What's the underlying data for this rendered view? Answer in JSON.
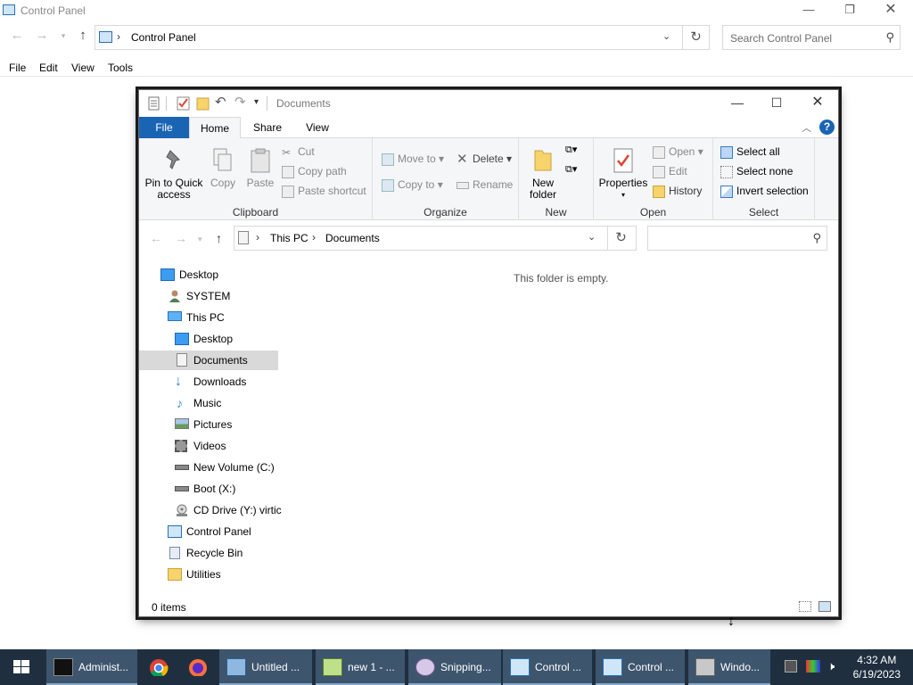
{
  "control_panel": {
    "title": "Control Panel",
    "address": {
      "separator": "›",
      "crumb": "Control Panel"
    },
    "search_placeholder": "Search Control Panel",
    "menu": [
      "File",
      "Edit",
      "View",
      "Tools"
    ]
  },
  "explorer": {
    "title": "Documents",
    "tabs": [
      "File",
      "Home",
      "Share",
      "View"
    ],
    "ribbon": {
      "clipboard": {
        "group_label": "Clipboard",
        "pin": "Pin to Quick access",
        "copy": "Copy",
        "paste": "Paste",
        "cut": "Cut",
        "copy_path": "Copy path",
        "paste_shortcut": "Paste shortcut"
      },
      "organize": {
        "group_label": "Organize",
        "move_to": "Move to",
        "copy_to": "Copy to",
        "delete": "Delete",
        "rename": "Rename"
      },
      "new": {
        "group_label": "New",
        "new_folder": "New folder"
      },
      "open": {
        "group_label": "Open",
        "properties": "Properties",
        "open": "Open",
        "edit": "Edit",
        "history": "History"
      },
      "select": {
        "group_label": "Select",
        "select_all": "Select all",
        "select_none": "Select none",
        "invert_selection": "Invert selection"
      }
    },
    "address": {
      "crumbs": [
        "This PC",
        "Documents"
      ],
      "separator": "›"
    },
    "nav_tree": [
      {
        "label": "Desktop",
        "icon": "desktop-icon",
        "level": 0
      },
      {
        "label": "SYSTEM",
        "icon": "user-icon",
        "level": 1
      },
      {
        "label": "This PC",
        "icon": "computer-icon",
        "level": 1
      },
      {
        "label": "Desktop",
        "icon": "desktop-icon",
        "level": 2
      },
      {
        "label": "Documents",
        "icon": "document-icon",
        "level": 2,
        "selected": true
      },
      {
        "label": "Downloads",
        "icon": "download-icon",
        "level": 2
      },
      {
        "label": "Music",
        "icon": "music-icon",
        "level": 2
      },
      {
        "label": "Pictures",
        "icon": "pictures-icon",
        "level": 2
      },
      {
        "label": "Videos",
        "icon": "videos-icon",
        "level": 2
      },
      {
        "label": "New Volume (C:)",
        "icon": "drive-icon",
        "level": 2
      },
      {
        "label": "Boot (X:)",
        "icon": "drive-icon",
        "level": 2
      },
      {
        "label": "CD Drive (Y:) virtic",
        "icon": "cd-drive-icon",
        "level": 2
      },
      {
        "label": "Control Panel",
        "icon": "control-panel-icon",
        "level": 1
      },
      {
        "label": "Recycle Bin",
        "icon": "recycle-bin-icon",
        "level": 1
      },
      {
        "label": "Utilities",
        "icon": "folder-icon",
        "level": 1
      }
    ],
    "empty_message": "This folder is empty.",
    "status": "0 items"
  },
  "taskbar": {
    "buttons": [
      {
        "label": "Administ...",
        "icon": "cmd-icon"
      },
      {
        "label": "",
        "icon": "chrome-icon"
      },
      {
        "label": "",
        "icon": "firefox-icon"
      },
      {
        "label": "Untitled ...",
        "icon": "notepad-icon"
      },
      {
        "label": "new 1 - ...",
        "icon": "notepadpp-icon"
      },
      {
        "label": "Snipping...",
        "icon": "snipping-icon"
      },
      {
        "label": "Control ...",
        "icon": "control-panel-icon"
      },
      {
        "label": "Control ...",
        "icon": "control-panel-icon"
      },
      {
        "label": "Windo...",
        "icon": "windows-setup-icon"
      }
    ],
    "clock": {
      "time": "4:32 AM",
      "date": "6/19/2023"
    }
  },
  "colors": {
    "accent": "#1a64b4",
    "taskbar": "#1f2f40",
    "selection": "#d9d9d9"
  }
}
